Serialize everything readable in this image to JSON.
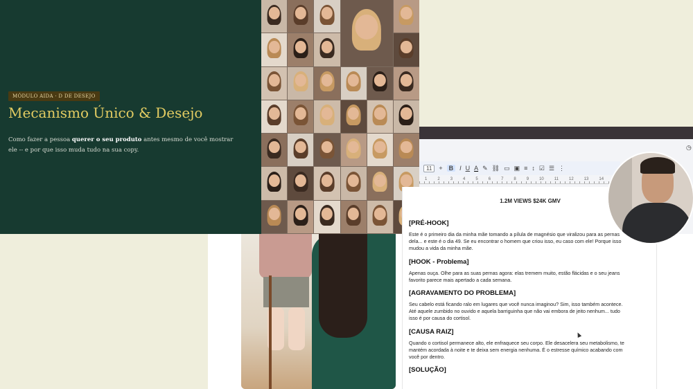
{
  "slide": {
    "badge": "MÓDULO AIDA · D DE DESEJO",
    "title": "Mecanismo Único & Desejo",
    "desc_pre": "Como fazer a pessoa ",
    "desc_bold": "querer o seu produto",
    "desc_post": " antes mesmo de você mostrar ele -- e por que isso muda tudo na sua copy."
  },
  "toolbar": {
    "font_size": "11",
    "plus": "+",
    "bold": "B",
    "italic": "I",
    "underline": "U",
    "text_color": "A"
  },
  "ruler_marks": [
    "1",
    "2",
    "3",
    "4",
    "5",
    "6",
    "7",
    "8",
    "9",
    "10",
    "11",
    "12",
    "13",
    "14"
  ],
  "document": {
    "top_line": "1.2M VIEWS $24K GMV",
    "sections": [
      {
        "heading": "[PRÉ-HOOK]",
        "body": "Este é o primeiro dia da minha mãe tomando a pílula de magnésio que viralizou para as pernas dela... e este é o dia 49. Se eu encontrar o homem que criou isso, eu caso com ele! Porque isso mudou a vida da minha mãe."
      },
      {
        "heading": "[HOOK - Problema]",
        "body": "Apenas ouça. Olhe para as suas pernas agora: elas tremem muito, estão flácidas e o seu jeans favorito parece mais apertado a cada semana."
      },
      {
        "heading": "[AGRAVAMENTO DO PROBLEMA]",
        "body": "Seu cabelo está ficando ralo em lugares que você nunca imaginou? Sim, isso também acontece. Até aquele zumbido no ouvido e aquela barriguinha que não vai embora de jeito nenhum... tudo isso é por causa do cortisol."
      },
      {
        "heading": "[CAUSA RAIZ]",
        "body": "Quando o cortisol permanece alto, ele enfraquece seu corpo. Ele desacelera seu metabolismo, te mantém acordada à noite e te deixa sem energia nenhuma. É o estresse químico acabando com você por dentro."
      },
      {
        "heading": "[SOLUÇÃO]",
        "body": ""
      }
    ]
  },
  "colors": {
    "slide_bg": "#173a30",
    "title_gold": "#e3cc62",
    "page_bg": "#efeedc"
  }
}
